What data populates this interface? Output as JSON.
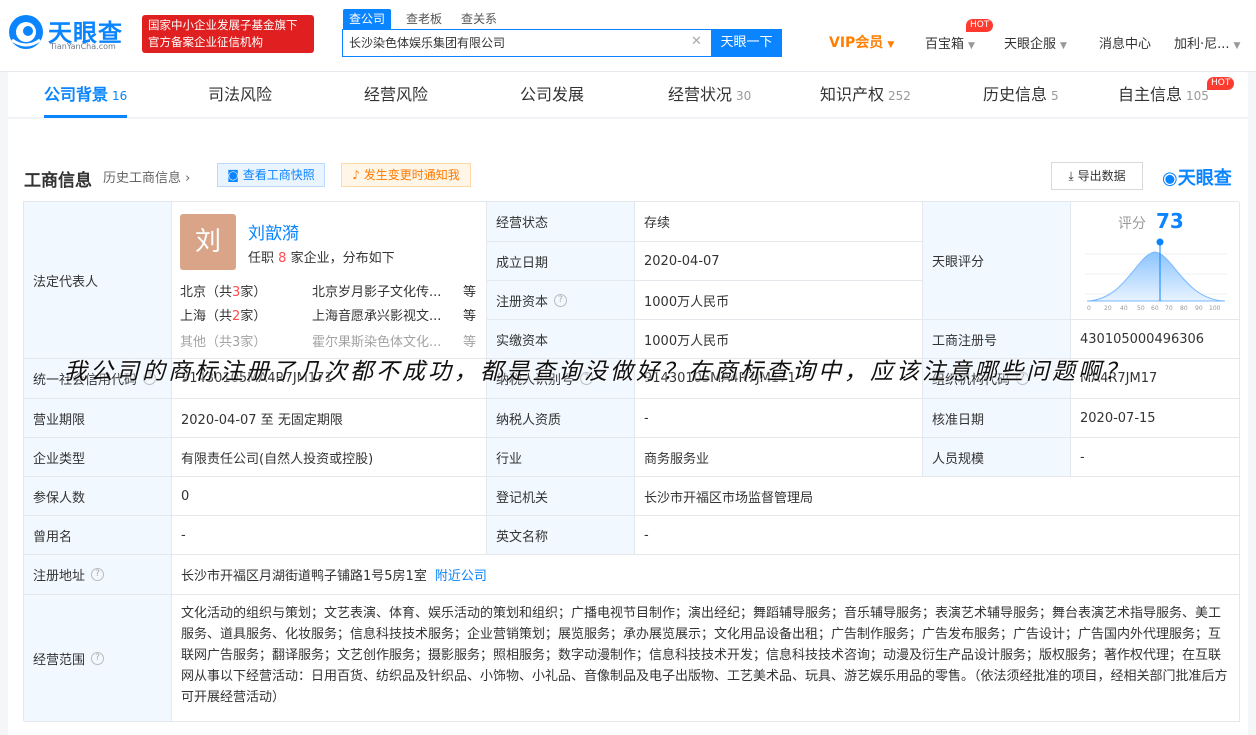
{
  "header": {
    "logo": {
      "cn": "天眼查",
      "en": "TianYanCha.com"
    },
    "banner": {
      "line1": "国家中小企业发展子基金旗下",
      "line2": "官方备案企业征信机构"
    },
    "search_tabs": [
      "查公司",
      "查老板",
      "查关系"
    ],
    "search_value": "长沙染色体娱乐集团有限公司",
    "search_button": "天眼一下",
    "nav": {
      "vip": "VIP会员",
      "baibaoxiang": "百宝箱",
      "hot": "HOT",
      "enterprise": "天眼企服",
      "message": "消息中心",
      "user": "加利·尼..."
    }
  },
  "tabs": [
    {
      "label": "公司背景",
      "count": "16"
    },
    {
      "label": "司法风险",
      "count": ""
    },
    {
      "label": "经营风险",
      "count": ""
    },
    {
      "label": "公司发展",
      "count": ""
    },
    {
      "label": "经营状况",
      "count": "30"
    },
    {
      "label": "知识产权",
      "count": "252"
    },
    {
      "label": "历史信息",
      "count": "5"
    },
    {
      "label": "自主信息",
      "count": "105"
    }
  ],
  "tab_hot": "HOT",
  "section": {
    "title": "工商信息",
    "history": "历史工商信息",
    "snapshot": "查看工商快照",
    "notify": "发生变更时通知我",
    "export": "导出数据",
    "brand": "天眼查"
  },
  "rep": {
    "label": "法定代表人",
    "avatar": "刘",
    "name": "刘歆漪",
    "desc_pre": "任职",
    "desc_num": "8",
    "desc_post": "家企业，分布如下",
    "rows": [
      {
        "city_name": "北京",
        "city_count": "3",
        "company": "北京岁月影子文化传...",
        "suffix": "等"
      },
      {
        "city_name": "上海",
        "city_count": "2",
        "company": "上海音愿承兴影视文...",
        "suffix": "等"
      },
      {
        "city_name": "其他",
        "city_count": "3",
        "company": "霍尔果斯染色体文化...",
        "suffix": "等"
      }
    ]
  },
  "info": {
    "status_label": "经营状态",
    "status": "存续",
    "founded_label": "成立日期",
    "founded": "2020-04-07",
    "capital_label": "注册资本",
    "capital": "1000万人民币",
    "paid_label": "实缴资本",
    "paid": "1000万人民币",
    "score_label": "天眼评分",
    "score_title": "评分",
    "score": "73",
    "score_ticks": [
      "0",
      "20",
      "40",
      "50",
      "60",
      "70",
      "80",
      "90",
      "100"
    ],
    "regno_label": "工商注册号",
    "regno": "430105000496306",
    "credit_label": "统一社会信用代码",
    "credit": "91430105MA4R7JM171",
    "taxid_label": "纳税人识别号",
    "taxid": "91430105MA4R7JM171",
    "org_label": "组织机构代码",
    "org": "MA4R7JM17",
    "term_label": "营业期限",
    "term": "2020-04-07  至 无固定期限",
    "taxpayer_label": "纳税人资质",
    "taxpayer": "-",
    "approve_label": "核准日期",
    "approve": "2020-07-15",
    "type_label": "企业类型",
    "type": "有限责任公司(自然人投资或控股)",
    "industry_label": "行业",
    "industry": "商务服务业",
    "staff_label": "人员规模",
    "staff": "-",
    "insured_label": "参保人数",
    "insured": "0",
    "authority_label": "登记机关",
    "authority": "长沙市开福区市场监督管理局",
    "former_label": "曾用名",
    "former": "-",
    "english_label": "英文名称",
    "english": "-",
    "address_label": "注册地址",
    "address": "长沙市开福区月湖街道鸭子铺路1号5房1室",
    "nearby": "附近公司",
    "scope_label": "经营范围",
    "scope": "文化活动的组织与策划；文艺表演、体育、娱乐活动的策划和组织；广播电视节目制作；演出经纪；舞蹈辅导服务；音乐辅导服务；表演艺术辅导服务；舞台表演艺术指导服务、美工服务、道具服务、化妆服务；信息科技技术服务；企业营销策划；展览服务；承办展览展示；文化用品设备出租；广告制作服务；广告发布服务；广告设计；广告国内外代理服务；互联网广告服务；翻译服务；文艺创作服务；摄影服务；照相服务；数字动漫制作；信息科技技术开发；信息科技技术咨询；动漫及衍生产品设计服务；版权服务；著作权代理；在互联网从事以下经营活动：日用百货、纺织品及针织品、小饰物、小礼品、音像制品及电子出版物、工艺美术品、玩具、游艺娱乐用品的零售。（依法须经批准的项目，经相关部门批准后方可开展经营活动）"
  },
  "caption": "我公司的商标注册了几次都不成功，都是查询没做好？在商标查询中，应该注意哪些问题啊？"
}
